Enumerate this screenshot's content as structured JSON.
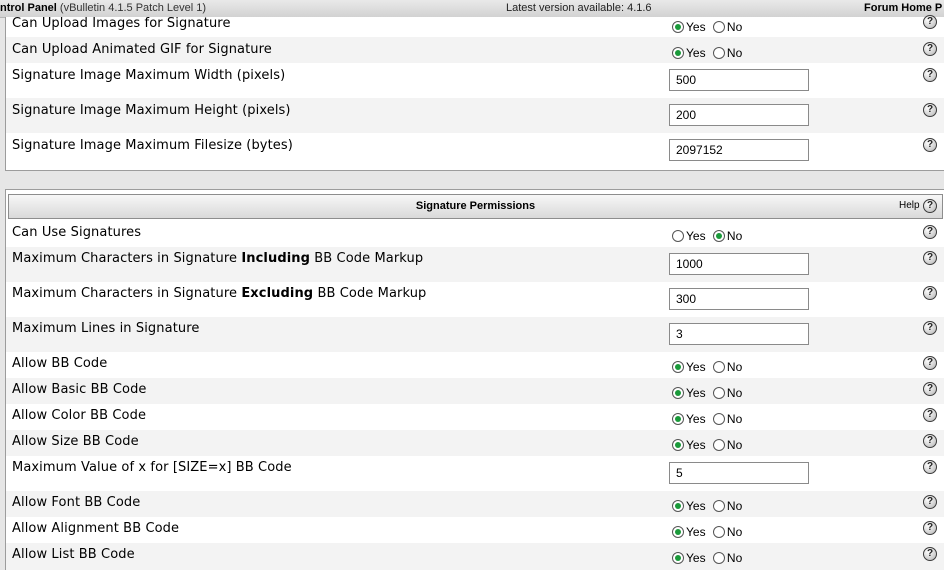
{
  "topbar": {
    "title": "ntrol Panel",
    "subtitle": "(vBulletin 4.1.5 Patch Level 1)",
    "version_text": "Latest version available: 4.1.6",
    "forum_home_link": "Forum Home P"
  },
  "radio_labels": {
    "yes": "Yes",
    "no": "No"
  },
  "help_glyph": "?",
  "image_section": {
    "rows": [
      {
        "label": "Can Upload Images for Signature",
        "type": "radio",
        "value": "Yes"
      },
      {
        "label": "Can Upload Animated GIF for Signature",
        "type": "radio",
        "value": "Yes"
      },
      {
        "label": "Signature Image Maximum Width (pixels)",
        "type": "text",
        "value": "500"
      },
      {
        "label": "Signature Image Maximum Height (pixels)",
        "type": "text",
        "value": "200"
      },
      {
        "label": "Signature Image Maximum Filesize (bytes)",
        "type": "text",
        "value": "2097152"
      }
    ]
  },
  "signature_permissions": {
    "title": "Signature Permissions",
    "help_label": "Help",
    "rows": [
      {
        "label": "Can Use Signatures",
        "type": "radio",
        "value": "No"
      },
      {
        "label_pre": "Maximum Characters in Signature ",
        "label_bold": "Including",
        "label_post": " BB Code Markup",
        "type": "text",
        "value": "1000"
      },
      {
        "label_pre": "Maximum Characters in Signature ",
        "label_bold": "Excluding",
        "label_post": " BB Code Markup",
        "type": "text",
        "value": "300"
      },
      {
        "label": "Maximum Lines in Signature",
        "type": "text",
        "value": "3"
      },
      {
        "label": "Allow BB Code",
        "type": "radio",
        "value": "Yes"
      },
      {
        "label": "Allow Basic BB Code",
        "type": "radio",
        "value": "Yes"
      },
      {
        "label": "Allow Color BB Code",
        "type": "radio",
        "value": "Yes"
      },
      {
        "label": "Allow Size BB Code",
        "type": "radio",
        "value": "Yes"
      },
      {
        "label": "Maximum Value of x for [SIZE=x] BB Code",
        "type": "text",
        "value": "5"
      },
      {
        "label": "Allow Font BB Code",
        "type": "radio",
        "value": "Yes"
      },
      {
        "label": "Allow Alignment BB Code",
        "type": "radio",
        "value": "Yes"
      },
      {
        "label": "Allow List BB Code",
        "type": "radio",
        "value": "Yes"
      }
    ]
  }
}
